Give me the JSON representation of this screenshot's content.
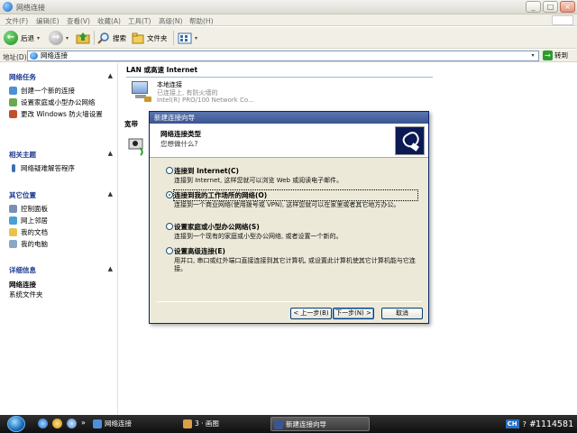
{
  "window": {
    "title": "网络连接",
    "btn_min": "_",
    "btn_max": "□",
    "btn_close": "×"
  },
  "menu": [
    "文件(F)",
    "编辑(E)",
    "查看(V)",
    "收藏(A)",
    "工具(T)",
    "高级(N)",
    "帮助(H)"
  ],
  "toolbar": {
    "back_label": "后退",
    "search_label": "搜索",
    "folders_label": "文件夹",
    "dropdown_glyph": "▾"
  },
  "address": {
    "label": "地址(D)",
    "value": "网络连接",
    "go_label": "转到"
  },
  "taskpane": {
    "network_tasks": {
      "title": "网络任务",
      "items": [
        "创建一个新的连接",
        "设置家庭或小型办公网络",
        "更改 Windows 防火墙设置"
      ]
    },
    "see_also": {
      "title": "相关主题",
      "items": [
        "网络疑难解答程序"
      ]
    },
    "other_places": {
      "title": "其它位置",
      "items": [
        "控制面板",
        "网上邻居",
        "我的文档",
        "我的电脑"
      ]
    },
    "details": {
      "title": "详细信息",
      "name": "网络连接",
      "desc": "系统文件夹"
    },
    "chevron": "▲"
  },
  "content": {
    "group_lan": "LAN 或高速 Internet",
    "conn_name": "本地连接",
    "conn_status": "已连接上, 有防火墙的",
    "conn_device": "Intel(R) PRO/100 Network Co...",
    "group_wizard": "宽带"
  },
  "wizard": {
    "title": "新建连接向导",
    "header_title": "网络连接类型",
    "header_sub": "您想做什么?",
    "options": [
      {
        "label": "连接到 Internet(C)",
        "desc": "连接到 Internet, 这样您就可以浏览 Web 或阅读电子邮件。"
      },
      {
        "label": "连接到我的工作场所的网络(O)",
        "desc": "连接到一个商业网络(使用拨号或 VPN), 这样您就可以在家里或者其它地方办公。"
      },
      {
        "label": "设置家庭或小型办公网络(S)",
        "desc": "连接到一个现有的家庭或小型办公网络, 或者设置一个新的。"
      },
      {
        "label": "设置高级连接(E)",
        "desc": "用并口, 串口或红外端口直接连接到其它计算机, 或设置此计算机使其它计算机能与它连接。"
      }
    ],
    "selected_index": 1,
    "back_btn": "< 上一步(B)",
    "next_btn": "下一步(N) >",
    "cancel_btn": "取消"
  },
  "taskbar": {
    "tasks": [
      "网络连接",
      "3 · 画图",
      "新建连接向导"
    ],
    "lang": "CH",
    "watermark": "#1114581"
  },
  "colors": {
    "title_blue": "#3a5590",
    "taskbar": "#1a1a1a",
    "panel_title": "#1d3a8f"
  }
}
